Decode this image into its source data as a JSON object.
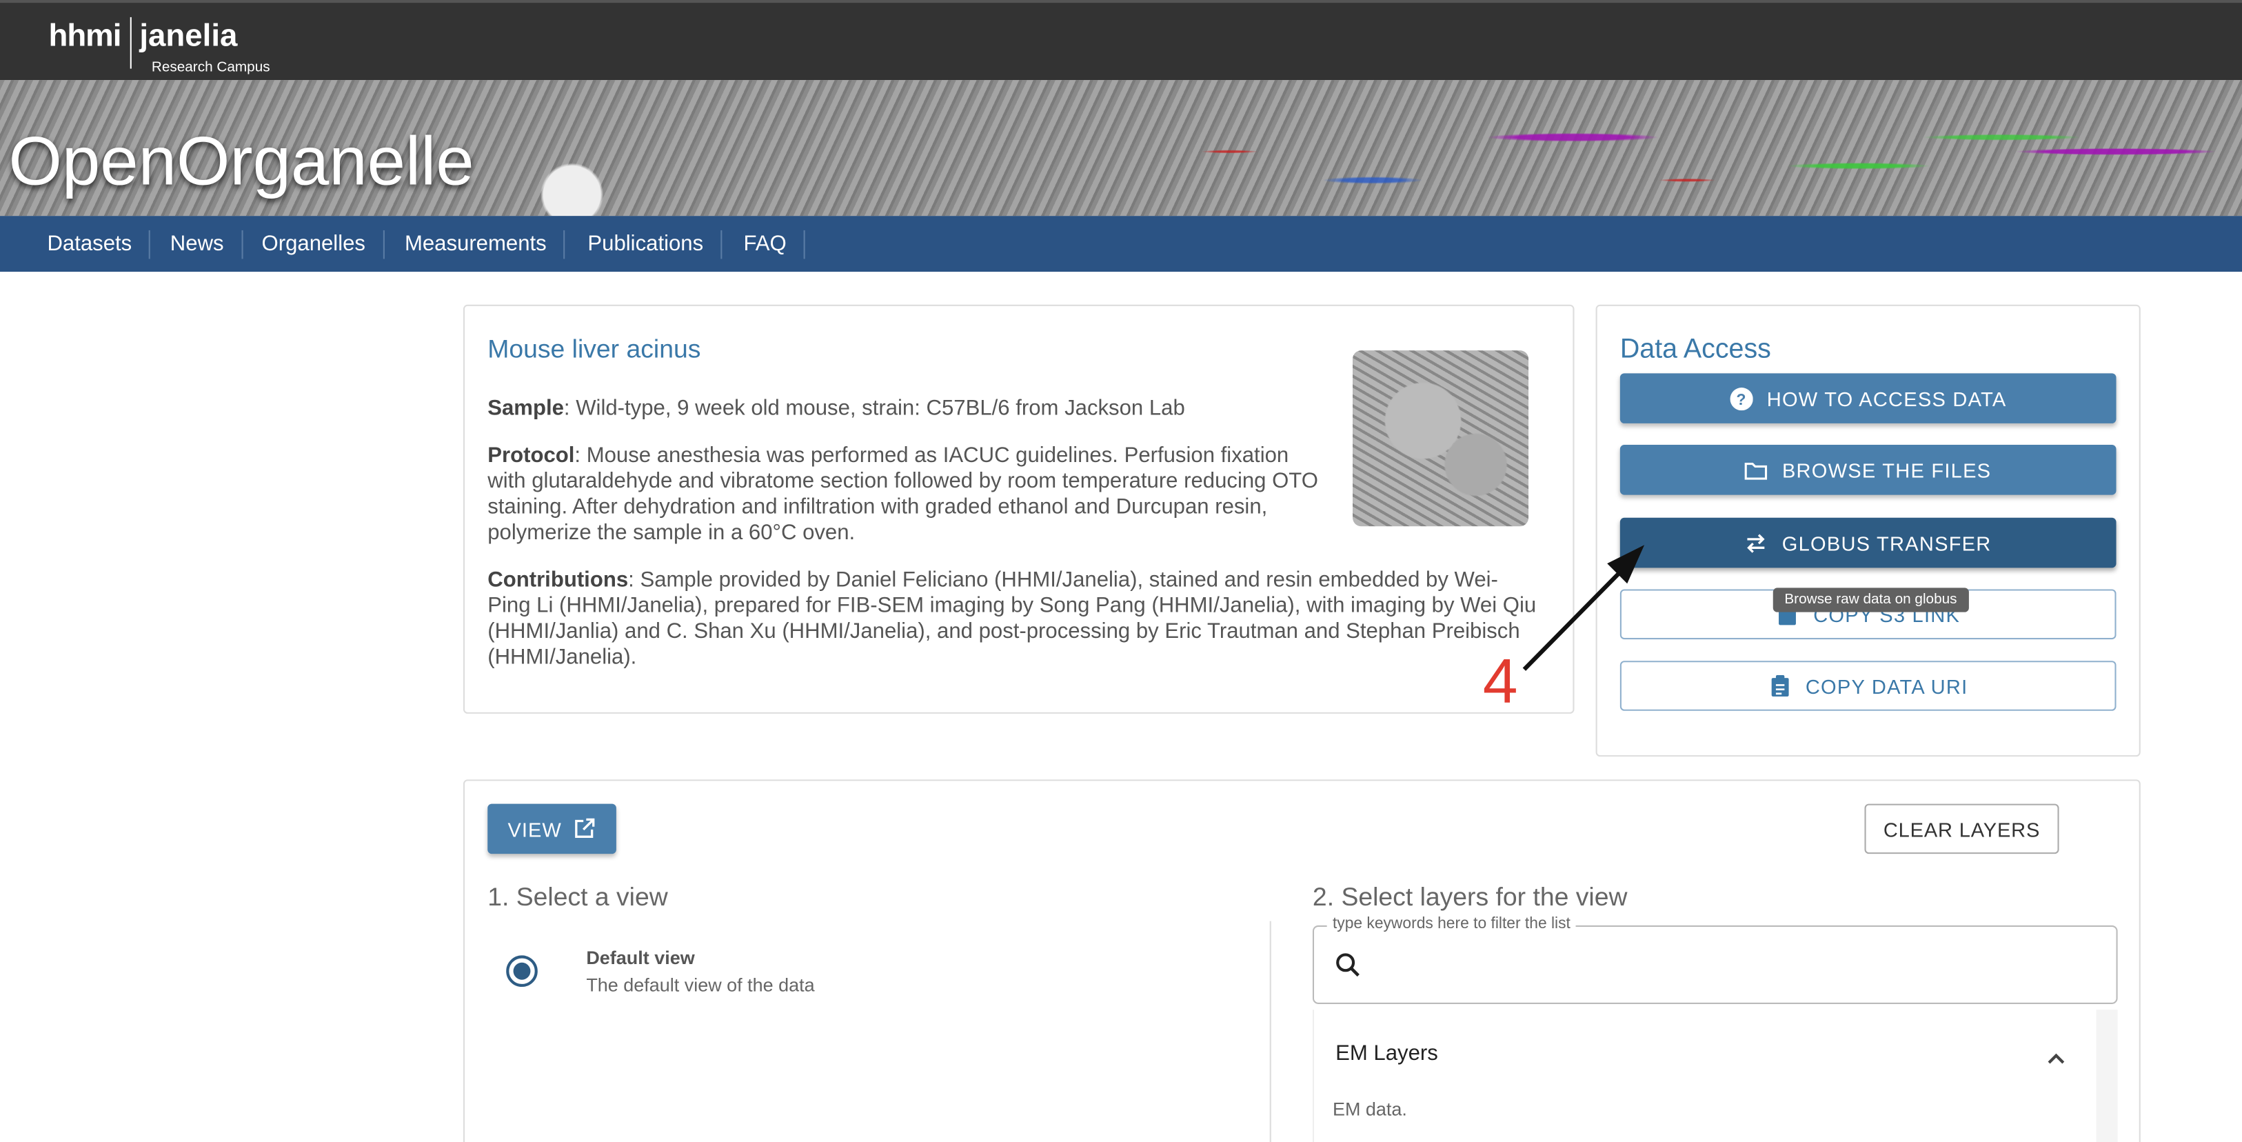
{
  "header": {
    "logo_hhmi": "hhmi",
    "logo_janelia": "janelia",
    "logo_campus": "Research Campus"
  },
  "banner": {
    "title": "OpenOrganelle"
  },
  "nav": {
    "items": [
      "Datasets",
      "News",
      "Organelles",
      "Measurements",
      "Publications",
      "FAQ"
    ]
  },
  "dataset": {
    "title": "Mouse liver acinus",
    "sample_label": "Sample",
    "sample_text": ": Wild-type, 9 week old mouse, strain: C57BL/6 from Jackson Lab",
    "protocol_label": "Protocol",
    "protocol_text": ": Mouse anesthesia was performed as IACUC guidelines. Perfusion fixation with glutaraldehyde and vibratome section followed by room temperature reducing OTO staining. After dehydration and infiltration with graded ethanol and Durcupan resin, polymerize the sample in a 60°C oven.",
    "contrib_label": "Contributions",
    "contrib_text": ": Sample provided by Daniel Feliciano (HHMI/Janelia), stained and resin embedded by Wei-Ping Li (HHMI/Janelia), prepared for FIB-SEM imaging by Song Pang (HHMI/Janelia), with imaging by Wei Qiu (HHMI/Janlia) and C. Shan Xu (HHMI/Janelia), and post-processing by Eric Trautman and Stephan Preibisch (HHMI/Janelia)."
  },
  "data_access": {
    "title": "Data Access",
    "how_label": "HOW TO ACCESS DATA",
    "browse_label": "BROWSE THE FILES",
    "globus_label": "GLOBUS TRANSFER",
    "s3_label": "COPY S3 LINK",
    "uri_label": "COPY DATA URI",
    "tooltip": "Browse raw data on globus"
  },
  "annotation": {
    "number": "4",
    "color": "#e23b2f"
  },
  "viewer": {
    "view_label": "VIEW",
    "clear_label": "CLEAR LAYERS",
    "select_view_title": "1. Select a view",
    "select_layers_title": "2. Select layers for the view",
    "default_view_label": "Default view",
    "default_view_desc": "The default view of the data",
    "filter_placeholder": "type keywords here to filter the list",
    "em_layers_title": "EM Layers",
    "em_layers_desc": "EM data."
  },
  "colors": {
    "nav": "#2b5384",
    "accent": "#4a7fac",
    "globus": "#2e5c84"
  }
}
